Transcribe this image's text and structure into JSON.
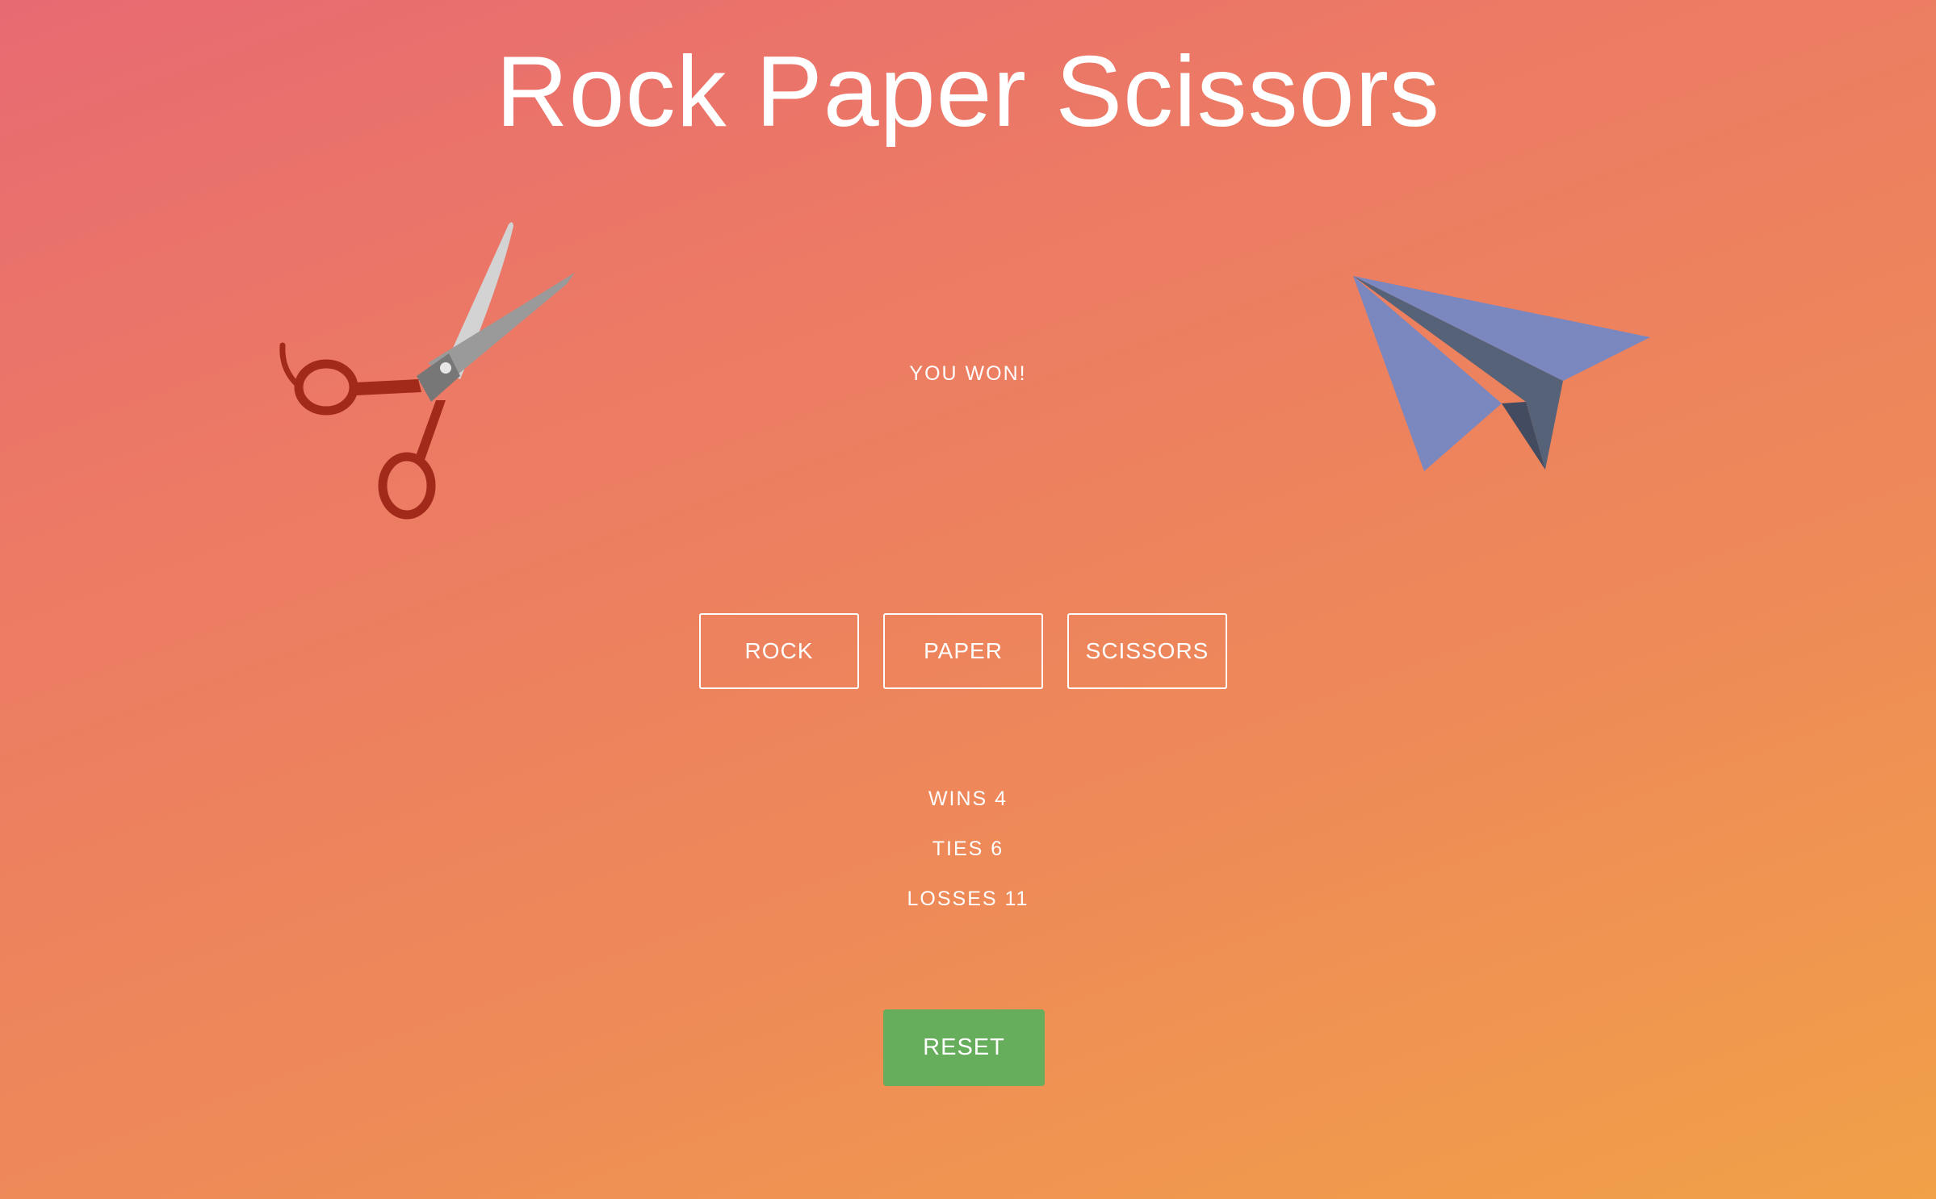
{
  "page": {
    "title": "Rock Paper Scissors"
  },
  "game": {
    "result": "YOU WON!",
    "player_choice_icon": "scissors-icon",
    "computer_choice_icon": "paper-plane-icon"
  },
  "choices": {
    "rock_label": "ROCK",
    "paper_label": "PAPER",
    "scissors_label": "SCISSORS"
  },
  "stats": {
    "wins": "WINS 4",
    "ties": "TIES 6",
    "losses": "LOSSES 11"
  },
  "actions": {
    "reset_label": "RESET"
  },
  "colors": {
    "background_start": "#e76a72",
    "background_end": "#f1a148",
    "reset_button": "#66ad5c",
    "paper_plane": "#7a88c0",
    "scissors_handle": "#a22a1a"
  }
}
